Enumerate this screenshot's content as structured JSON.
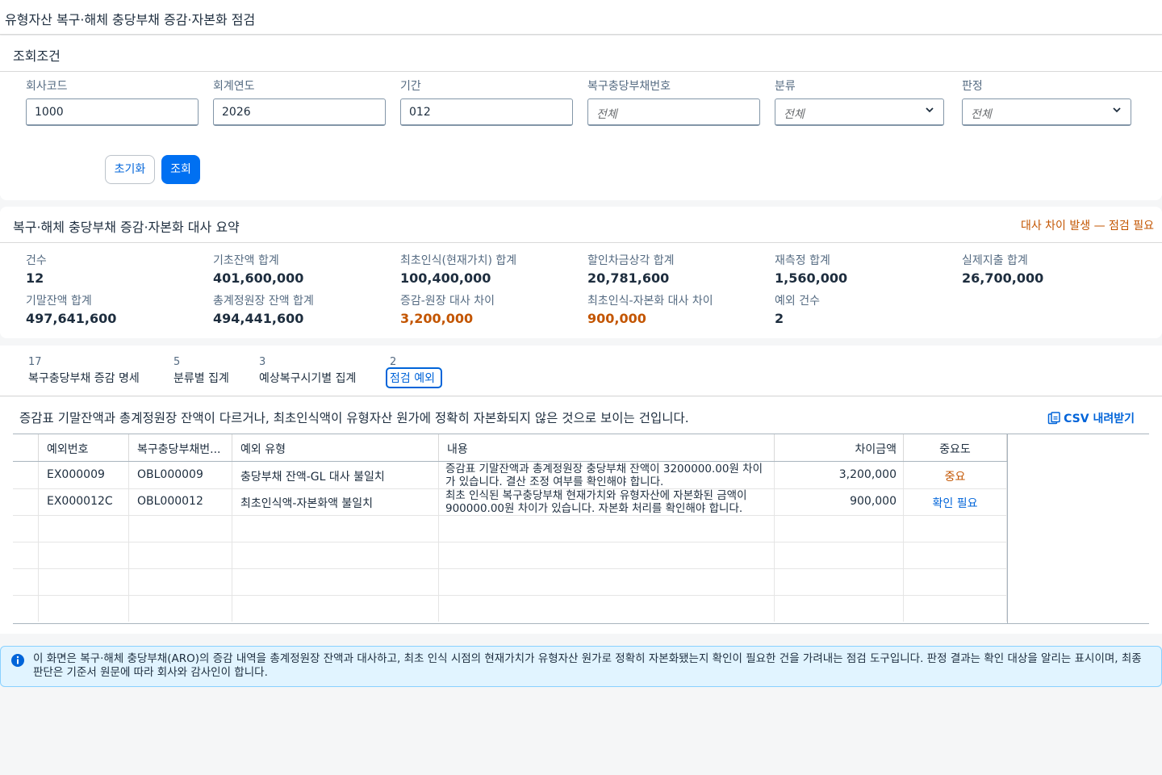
{
  "app": {
    "title": "유형자산 복구·해체 충당부채 증감·자본화 점검"
  },
  "filter": {
    "title": "조회조건",
    "fields": [
      {
        "label": "회사코드",
        "value": "1000",
        "placeholder": ""
      },
      {
        "label": "회계연도",
        "value": "2026",
        "placeholder": ""
      },
      {
        "label": "기간",
        "value": "012",
        "placeholder": ""
      },
      {
        "label": "복구충당부채번호",
        "value": "",
        "placeholder": "전체"
      },
      {
        "label": "분류",
        "value": "",
        "placeholder": "전체"
      },
      {
        "label": "판정",
        "value": "",
        "placeholder": "전체"
      }
    ],
    "reset_label": "초기화",
    "search_label": "조회"
  },
  "summary": {
    "title": "복구·해체 충당부채 증감·자본화 대사 요약",
    "warning": "대사 차이 발생 — 점검 필요",
    "kpis": [
      {
        "label": "건수",
        "value": "12"
      },
      {
        "label": "기초잔액 합계",
        "value": "401,600,000"
      },
      {
        "label": "최초인식(현재가치) 합계",
        "value": "100,400,000"
      },
      {
        "label": "할인차금상각 합계",
        "value": "20,781,600"
      },
      {
        "label": "재측정 합계",
        "value": "1,560,000"
      },
      {
        "label": "실제지출 합계",
        "value": "26,700,000"
      },
      {
        "label": "기말잔액 합계",
        "value": "497,641,600"
      },
      {
        "label": "총계정원장 잔액 합계",
        "value": "494,441,600"
      },
      {
        "label": "증감-원장 대사 차이",
        "value": "3,200,000"
      },
      {
        "label": "최초인식-자본화 대사 차이",
        "value": "900,000"
      },
      {
        "label": "예외 건수",
        "value": "2"
      }
    ]
  },
  "tabs": [
    {
      "count": "17",
      "label": "복구충당부채 증감 명세"
    },
    {
      "count": "5",
      "label": "분류별 집계"
    },
    {
      "count": "3",
      "label": "예상복구시기별 집계"
    },
    {
      "count": "2",
      "label": "점검 예외"
    }
  ],
  "exceptions": {
    "description": "증감표 기말잔액과 총계정원장 잔액이 다르거나, 최초인식액이 유형자산 원가에 정확히 자본화되지 않은 것으로 보이는 건입니다.",
    "csv_label": "CSV 내려받기",
    "columns": [
      "예외번호",
      "복구충당부채번...",
      "예외 유형",
      "내용",
      "차이금액",
      "중요도"
    ],
    "rows": [
      {
        "id": "EX000009",
        "obligation": "OBL000009",
        "type": "충당부채 잔액-GL 대사 불일치",
        "content": "증감표 기말잔액과 총계정원장 충당부채 잔액이 3200000.00원 차이가 있습니다. 결산 조정 여부를 확인해야 합니다.",
        "amount": "3,200,000",
        "severity": "중요"
      },
      {
        "id": "EX000012C",
        "obligation": "OBL000012",
        "type": "최초인식액-자본화액 불일치",
        "content": "최초 인식된 복구충당부채 현재가치와 유형자산에 자본화된 금액이 900000.00원 차이가 있습니다. 자본화 처리를 확인해야 합니다.",
        "amount": "900,000",
        "severity": "확인 필요"
      }
    ]
  },
  "info": {
    "message": "이 화면은 복구·해체 충당부채(ARO)의 증감 내역을 총계정원장 잔액과 대사하고, 최초 인식 시점의 현재가치가 유형자산 원가로 정확히 자본화됐는지 확인이 필요한 건을 가려내는 점검 도구입니다. 판정 결과는 확인 대상을 알리는 표시이며, 최종 판단은 기준서 원문에 따라 회사와 감사인이 합니다."
  },
  "colors": {
    "accent": "#0070f2",
    "link": "#0064d9",
    "warning": "#c35500",
    "info_bg": "#e1f4ff"
  }
}
